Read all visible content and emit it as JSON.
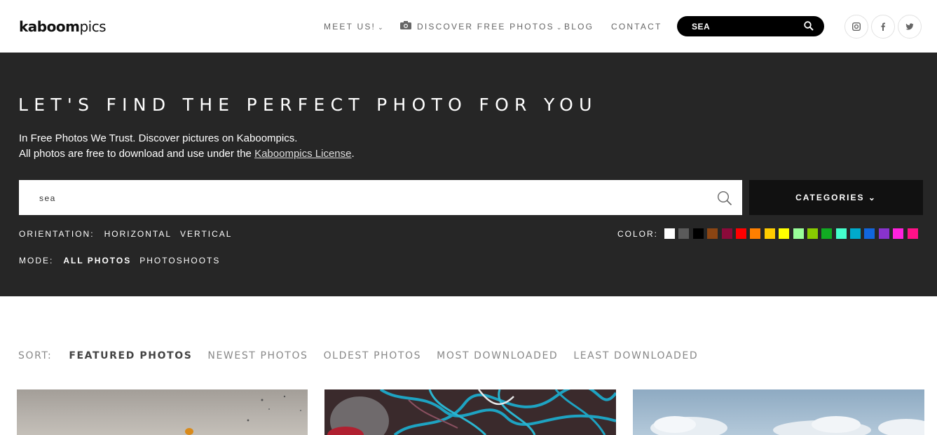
{
  "header": {
    "logo_bold": "kaboom",
    "logo_light": "pics",
    "nav": {
      "meet_us": "MEET US!",
      "discover": "DISCOVER FREE PHOTOS",
      "blog": "BLOG",
      "contact": "CONTACT"
    },
    "search_value": "SEA",
    "social": [
      "instagram-icon",
      "facebook-icon",
      "twitter-icon"
    ]
  },
  "hero": {
    "title": "LET'S FIND THE PERFECT PHOTO FOR YOU",
    "intro_line1": "In Free Photos We Trust. Discover pictures on Kaboompics.",
    "intro_line2_prefix": "All photos are free to download and use under the ",
    "license_link": "Kaboompics License",
    "intro_line2_suffix": ".",
    "search_value": "sea",
    "categories_label": "CATEGORIES",
    "orientation_label": "ORIENTATION:",
    "orientation_options": [
      "HORIZONTAL",
      "VERTICAL"
    ],
    "color_label": "COLOR:",
    "colors": [
      "#ffffff",
      "#5b5b5b",
      "#000000",
      "#8b4513",
      "#8b0a3a",
      "#ff0000",
      "#ff7f00",
      "#ffcc00",
      "#ffff00",
      "#99ff99",
      "#88cc00",
      "#11aa22",
      "#44ffcc",
      "#00aacc",
      "#1166dd",
      "#8833cc",
      "#ff22dd",
      "#ff1188"
    ],
    "mode_label": "MODE:",
    "mode_options": [
      "ALL PHOTOS",
      "PHOTOSHOOTS"
    ]
  },
  "sort": {
    "label": "SORT:",
    "options": [
      "FEATURED PHOTOS",
      "NEWEST PHOTOS",
      "OLDEST PHOTOS",
      "MOST DOWNLOADED",
      "LEAST DOWNLOADED"
    ]
  }
}
